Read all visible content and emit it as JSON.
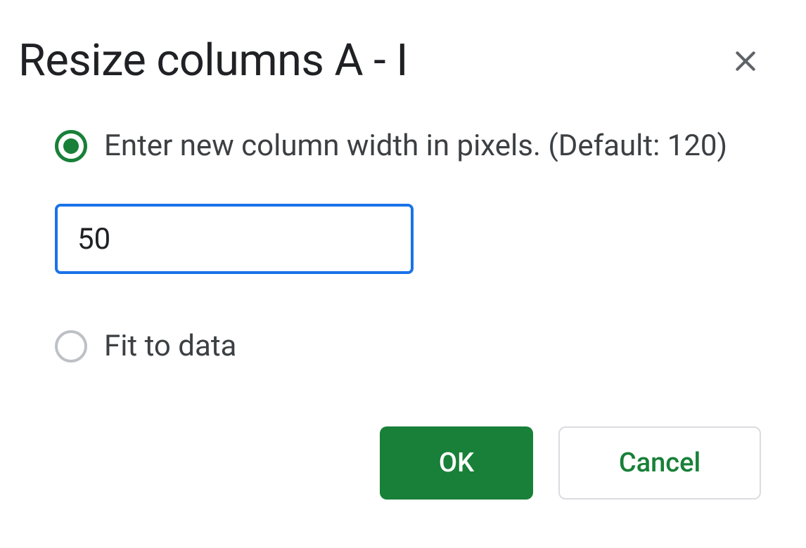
{
  "dialog": {
    "title": "Resize columns A - I",
    "options": {
      "enter_width": {
        "label": "Enter new column width in pixels. (Default: 120)",
        "selected": true,
        "value": "50"
      },
      "fit_to_data": {
        "label": "Fit to data",
        "selected": false
      }
    },
    "buttons": {
      "ok": "OK",
      "cancel": "Cancel"
    }
  }
}
